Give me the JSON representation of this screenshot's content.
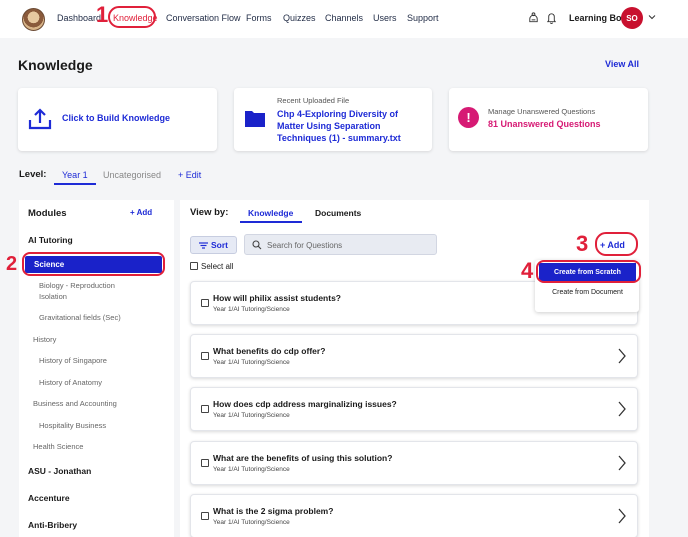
{
  "nav": {
    "items": [
      "Dashboard",
      "Knowledge",
      "Conversation Flow",
      "Forms",
      "Quizzes",
      "Channels",
      "Users",
      "Support"
    ],
    "active": "Knowledge",
    "user_name": "Learning Bot",
    "avatar_initials": "SO"
  },
  "annotations": [
    "1",
    "2",
    "3",
    "4"
  ],
  "page": {
    "title": "Knowledge",
    "view_all": "View All"
  },
  "cards": {
    "build": {
      "label": "Click to Build Knowledge"
    },
    "recent": {
      "caption": "Recent Uploaded File",
      "line1": "Chp 4-Exploring Diversity of",
      "line2": "Matter Using Separation",
      "line3": "Techniques (1) - summary.txt"
    },
    "unanswered": {
      "caption": "Manage Unanswered Questions",
      "value": "81 Unanswered Questions"
    }
  },
  "level": {
    "label": "Level:",
    "tabs": [
      "Year 1",
      "Uncategorised"
    ],
    "active": "Year 1",
    "edit": "+ Edit"
  },
  "modules": {
    "title": "Modules",
    "add": "+ Add",
    "tree": [
      "AI Tutoring",
      "Science",
      "Biology - Reproduction",
      "Isolation",
      "Gravitational fields (Sec)",
      "History",
      "History of Singapore",
      "History of Anatomy",
      "Business and Accounting",
      "Hospitality Business",
      "Health Science",
      "ASU - Jonathan",
      "Accenture",
      "Anti-Bribery"
    ],
    "selected": "Science"
  },
  "content": {
    "view_by": "View by:",
    "tabs": [
      "Knowledge",
      "Documents"
    ],
    "active_tab": "Knowledge",
    "sort": "Sort",
    "search_placeholder": "Search for Questions",
    "select_all": "Select all",
    "add": "+ Add",
    "dropdown": [
      "Create from Scratch",
      "Create from Document"
    ],
    "questions": [
      {
        "title": "How will philix assist students?",
        "path": "Year 1/AI Tutoring/Science"
      },
      {
        "title": "What benefits do cdp offer?",
        "path": "Year 1/AI Tutoring/Science"
      },
      {
        "title": "How does cdp address marginalizing issues?",
        "path": "Year 1/AI Tutoring/Science"
      },
      {
        "title": "What are the benefits of using this solution?",
        "path": "Year 1/AI Tutoring/Science"
      },
      {
        "title": "What is the 2 sigma problem?",
        "path": "Year 1/AI Tutoring/Science"
      }
    ]
  },
  "colors": {
    "accent": "#1e2bd6",
    "annotation": "#e0203a",
    "unanswered": "#d61a74",
    "avatar": "#c8102e"
  }
}
